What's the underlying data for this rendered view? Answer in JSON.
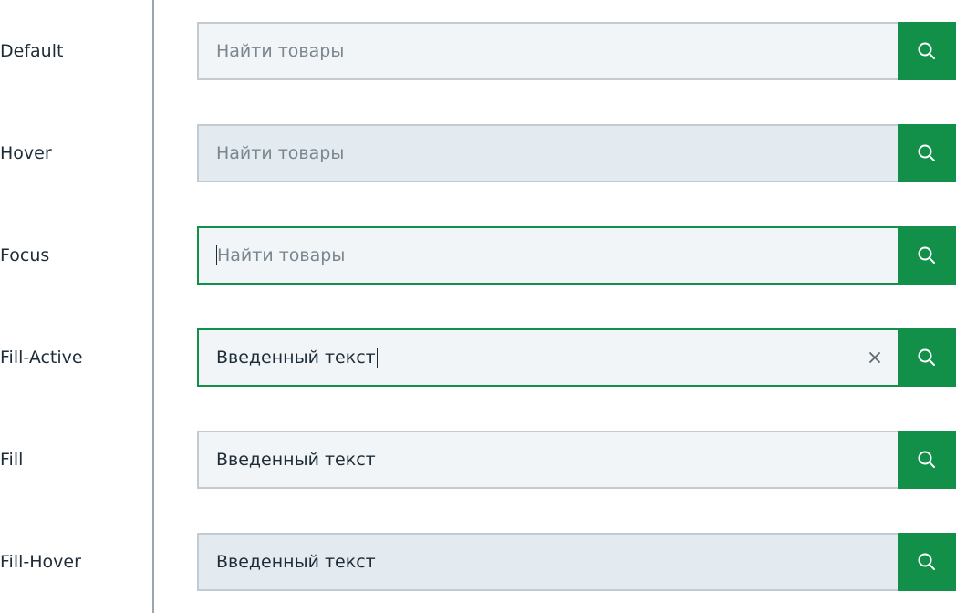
{
  "states": [
    {
      "label": "Default",
      "placeholder": "Найти товары",
      "value": ""
    },
    {
      "label": "Hover",
      "placeholder": "Найти товары",
      "value": ""
    },
    {
      "label": "Focus",
      "placeholder": "Найти товары",
      "value": ""
    },
    {
      "label": "Fill-Active",
      "placeholder": "",
      "value": "Введенный текст"
    },
    {
      "label": "Fill",
      "placeholder": "",
      "value": "Введенный текст"
    },
    {
      "label": "Fill-Hover",
      "placeholder": "",
      "value": "Введенный текст"
    }
  ],
  "icons": {
    "search_button": "search-icon",
    "clear_button": "close-icon"
  },
  "colors": {
    "accent": "#12904a",
    "field_bg": "#f1f5f8",
    "field_hover_bg": "#e3eaf0",
    "field_border": "#c4cbd0",
    "placeholder_text": "#7a878f",
    "value_text": "#1d2c38",
    "divider": "#9aa5ad"
  }
}
